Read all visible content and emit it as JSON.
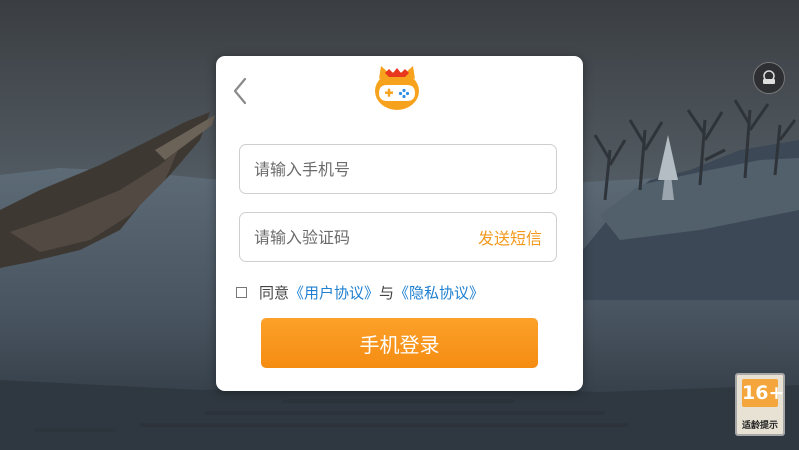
{
  "login": {
    "phone_placeholder": "请输入手机号",
    "code_placeholder": "请输入验证码",
    "send_sms_label": "发送短信",
    "agree_prefix": "同意",
    "user_agreement_label": "《用户协议》",
    "and_text": "与",
    "privacy_policy_label": "《隐私协议》",
    "login_button_label": "手机登录"
  },
  "age_rating": {
    "value": "16+",
    "label": "适龄提示"
  },
  "colors": {
    "accent": "#f7921a",
    "link": "#1e7fd0"
  },
  "icons": {
    "back": "chevron-left-icon",
    "logo": "game-cat-logo-icon",
    "top_right": "service-icon"
  }
}
